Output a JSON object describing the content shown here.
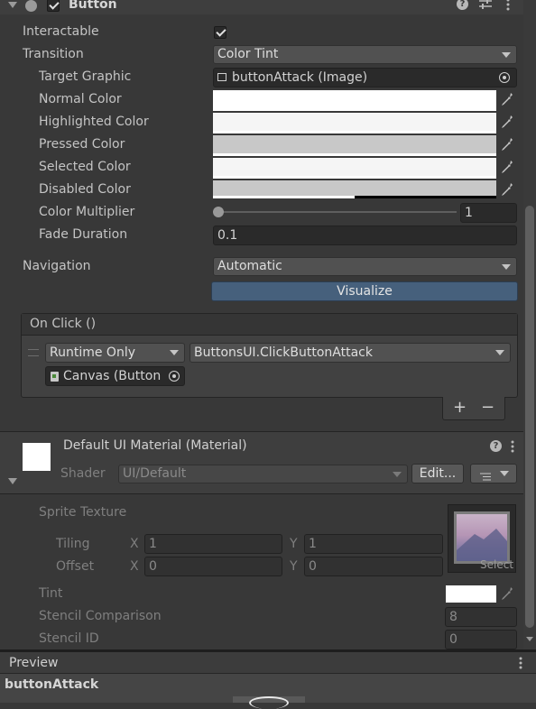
{
  "component": {
    "name": "Button"
  },
  "props": {
    "interactable_label": "Interactable",
    "transition_label": "Transition",
    "transition_value": "Color Tint",
    "target_graphic_label": "Target Graphic",
    "target_graphic_value": "buttonAttack (Image)",
    "normal_color_label": "Normal Color",
    "highlighted_color_label": "Highlighted Color",
    "pressed_color_label": "Pressed Color",
    "selected_color_label": "Selected Color",
    "disabled_color_label": "Disabled Color",
    "color_multiplier_label": "Color Multiplier",
    "color_multiplier_value": "1",
    "fade_duration_label": "Fade Duration",
    "fade_duration_value": "0.1",
    "navigation_label": "Navigation",
    "navigation_value": "Automatic",
    "visualize_label": "Visualize",
    "colors": {
      "normal": "#ffffff",
      "highlighted": "#f5f5f5",
      "pressed": "#c8c8c8",
      "selected": "#f5f5f5",
      "disabled": "#c8c8c8"
    }
  },
  "onclick": {
    "header": "On Click ()",
    "runtime_value": "Runtime Only",
    "function_value": "ButtonsUI.ClickButtonAttack",
    "object_value": "Canvas (Button",
    "add_label": "+",
    "remove_label": "−"
  },
  "material": {
    "title": "Default UI Material (Material)",
    "shader_label": "Shader",
    "shader_value": "UI/Default",
    "edit_label": "Edit...",
    "sprite_texture_label": "Sprite Texture",
    "tiling_label": "Tiling",
    "offset_label": "Offset",
    "x_label": "X",
    "y_label": "Y",
    "tiling_x": "1",
    "tiling_y": "1",
    "offset_x": "0",
    "offset_y": "0",
    "select_label": "Select",
    "tint_label": "Tint",
    "stencil_comparison_label": "Stencil Comparison",
    "stencil_comparison_value": "8",
    "stencil_id_label": "Stencil ID",
    "stencil_id_value": "0"
  },
  "preview": {
    "title": "Preview",
    "object_name": "buttonAttack"
  }
}
